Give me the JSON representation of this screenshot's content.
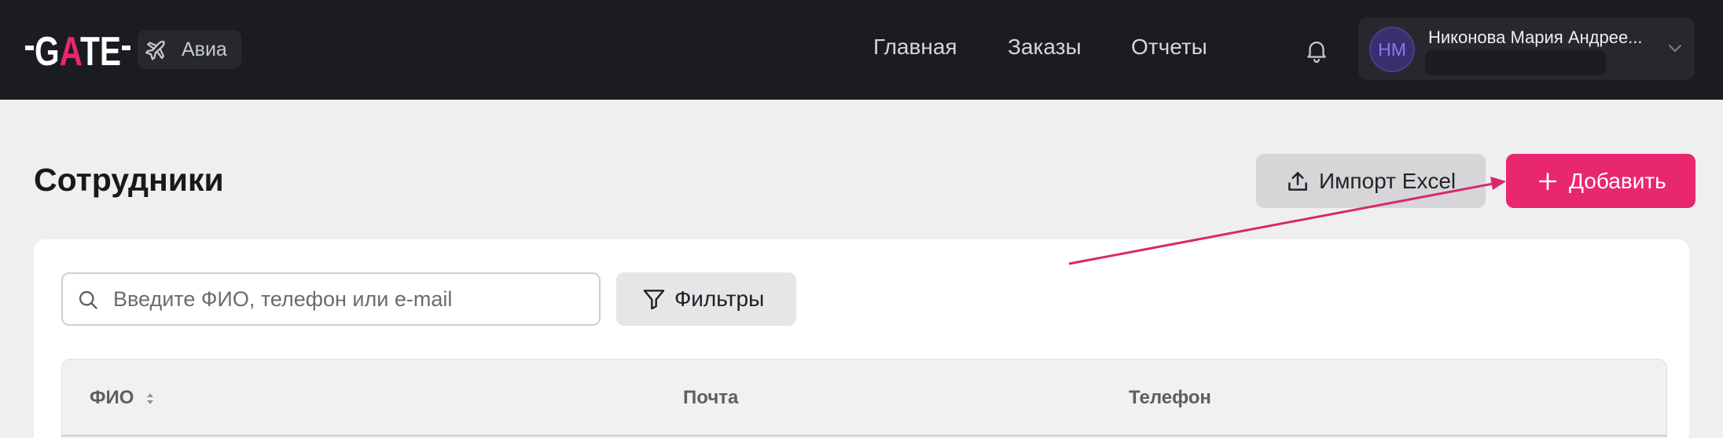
{
  "header": {
    "logo_text": "GATE",
    "product_label": "Авиа",
    "nav": [
      "Главная",
      "Заказы",
      "Отчеты"
    ],
    "user": {
      "initials": "НМ",
      "name": "Никонова Мария Андрее...",
      "sub": ""
    }
  },
  "page": {
    "title": "Сотрудники",
    "import_label": "Импорт Excel",
    "add_label": "Добавить"
  },
  "toolbar": {
    "search_placeholder": "Введите ФИО, телефон или e-mail",
    "filter_label": "Фильтры"
  },
  "table": {
    "columns": [
      "ФИО",
      "Почта",
      "Телефон"
    ]
  },
  "colors": {
    "brand": "#e8276f",
    "topbar": "#1b1c20",
    "background": "#efefef",
    "avatar_text": "#8d73ff"
  },
  "icons": [
    "plane-icon",
    "bell-icon",
    "chevron-down-icon",
    "upload-icon",
    "plus-icon",
    "search-icon",
    "filter-icon",
    "sort-icon"
  ]
}
